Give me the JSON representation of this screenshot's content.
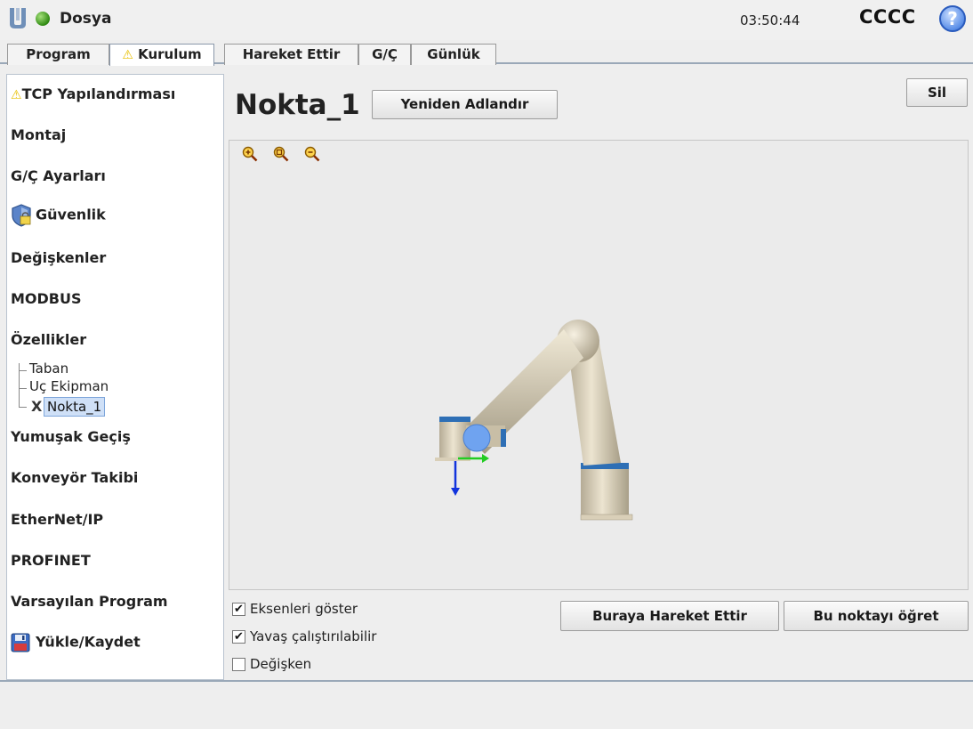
{
  "header": {
    "file_menu": "Dosya",
    "time": "03:50:44",
    "robot_name": "CCCC",
    "help_glyph": "?"
  },
  "tabs": [
    {
      "label": "Program",
      "warning": false,
      "active": false
    },
    {
      "label": "Kurulum",
      "warning": true,
      "active": true
    },
    {
      "label": "Hareket Ettir",
      "warning": false,
      "active": false
    },
    {
      "label": "G/Ç",
      "warning": false,
      "active": false
    },
    {
      "label": "Günlük",
      "warning": false,
      "active": false
    }
  ],
  "sidebar": {
    "items": [
      {
        "label": "TCP Yapılandırması",
        "icon": "warning-icon"
      },
      {
        "label": "Montaj"
      },
      {
        "label": "G/Ç Ayarları"
      },
      {
        "label": "Güvenlik",
        "icon": "shield-icon"
      },
      {
        "label": "Değişkenler"
      },
      {
        "label": "MODBUS"
      },
      {
        "label": "Özellikler"
      },
      {
        "label": "Yumuşak Geçiş"
      },
      {
        "label": "Konveyör Takibi"
      },
      {
        "label": "EtherNet/IP"
      },
      {
        "label": "PROFINET"
      },
      {
        "label": "Varsayılan Program"
      },
      {
        "label": "Yükle/Kaydet",
        "icon": "floppy-disk-icon"
      }
    ],
    "features_tree": [
      {
        "label": "Taban"
      },
      {
        "label": "Uç Ekipman"
      },
      {
        "label": "Nokta_1",
        "selected": true
      }
    ],
    "selected_marker": "X"
  },
  "main": {
    "point_name": "Nokta_1",
    "rename_button": "Yeniden Adlandır",
    "delete_button": "Sil",
    "move_here_button": "Buraya Hareket Ettir",
    "teach_point_button": "Bu noktayı öğret",
    "options": [
      {
        "label": "Eksenleri göster",
        "checked": true,
        "mark": "✔"
      },
      {
        "label": "Yavaş çalıştırılabilir",
        "checked": true,
        "mark": "✔"
      },
      {
        "label": "Değişken",
        "checked": false,
        "mark": ""
      }
    ],
    "zoom_icons": [
      "zoom-in-icon",
      "zoom-fit-icon",
      "zoom-out-icon"
    ]
  },
  "colors": {
    "accent_blue": "#2b60c6",
    "warning_yellow": "#e8c000",
    "robot_beige": "#d9cfb8",
    "ring_blue": "#2e6fb5"
  }
}
